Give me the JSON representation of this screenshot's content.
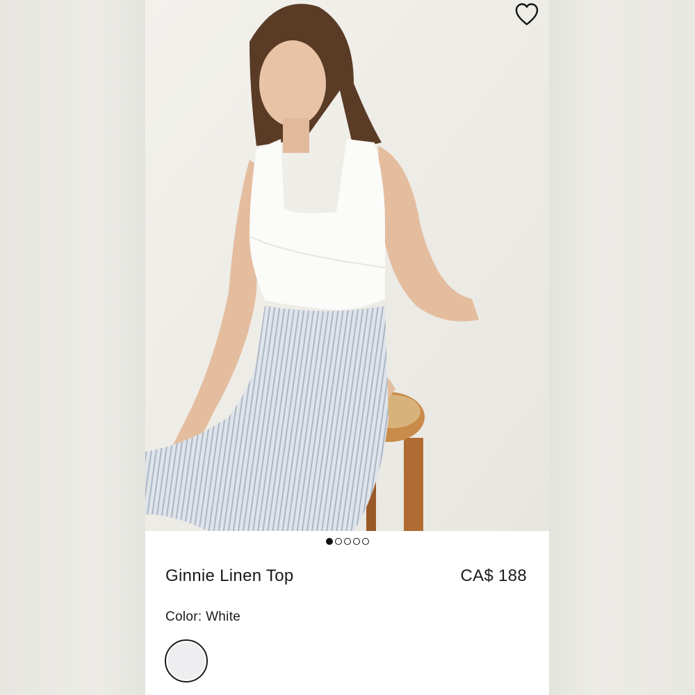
{
  "product": {
    "name": "Ginnie Linen Top",
    "price": "CA$ 188",
    "color_label": "Color:",
    "color_value": "White",
    "swatch_color": "#eeeef0",
    "image_alt": "Model wearing white linen cropped top with striped pants, seated on wooden stool"
  },
  "carousel": {
    "total": 5,
    "active_index": 0
  },
  "icons": {
    "wishlist": "heart-outline-icon"
  },
  "colors": {
    "background": "#ffffff",
    "text": "#1a1a1a",
    "image_backdrop": "#eeece7"
  }
}
